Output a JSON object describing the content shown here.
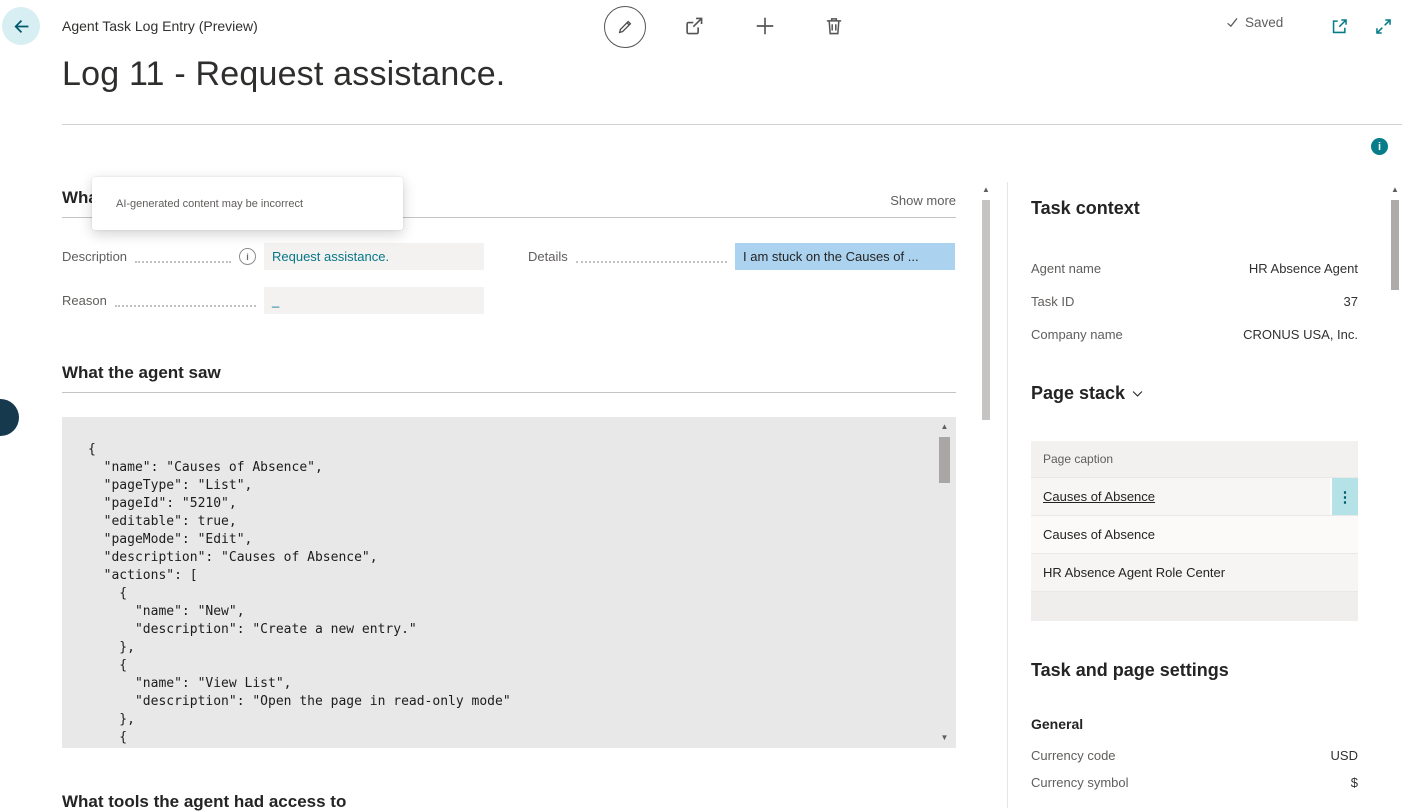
{
  "header": {
    "app_title": "Agent Task Log Entry (Preview)",
    "saved_label": "Saved"
  },
  "page": {
    "title": "Log 11 - Request assistance."
  },
  "tooltip": {
    "text": "AI-generated content may be incorrect"
  },
  "what_happened": {
    "heading": "What happened",
    "show_more_label": "Show more",
    "fields": {
      "description": {
        "label": "Description",
        "value": "Request assistance."
      },
      "details": {
        "label": "Details",
        "value": "I am stuck on the Causes of ..."
      },
      "reason": {
        "label": "Reason",
        "value": "_"
      }
    }
  },
  "agent_saw": {
    "heading": "What the agent saw",
    "code": "{\n  \"name\": \"Causes of Absence\",\n  \"pageType\": \"List\",\n  \"pageId\": \"5210\",\n  \"editable\": true,\n  \"pageMode\": \"Edit\",\n  \"description\": \"Causes of Absence\",\n  \"actions\": [\n    {\n      \"name\": \"New\",\n      \"description\": \"Create a new entry.\"\n    },\n    {\n      \"name\": \"View List\",\n      \"description\": \"Open the page in read-only mode\"\n    },\n    {"
  },
  "tools_section": {
    "heading": "What tools the agent had access to"
  },
  "factbox": {
    "task_context": {
      "heading": "Task context",
      "rows": [
        {
          "label": "Agent name",
          "value": "HR Absence Agent"
        },
        {
          "label": "Task ID",
          "value": "37"
        },
        {
          "label": "Company name",
          "value": "CRONUS USA, Inc."
        }
      ]
    },
    "page_stack": {
      "heading": "Page stack",
      "column_header": "Page caption",
      "rows": [
        "Causes of Absence",
        "Causes of Absence",
        "HR Absence Agent Role Center"
      ]
    },
    "settings": {
      "heading": "Task and page settings",
      "group_label": "General",
      "rows": [
        {
          "label": "Currency code",
          "value": "USD"
        },
        {
          "label": "Currency symbol",
          "value": "$"
        }
      ]
    }
  },
  "colors": {
    "accent": "#077c8a",
    "selection": "#abd3f0",
    "field_bg": "#f3f2f1",
    "code_bg": "#e8e8e8"
  }
}
